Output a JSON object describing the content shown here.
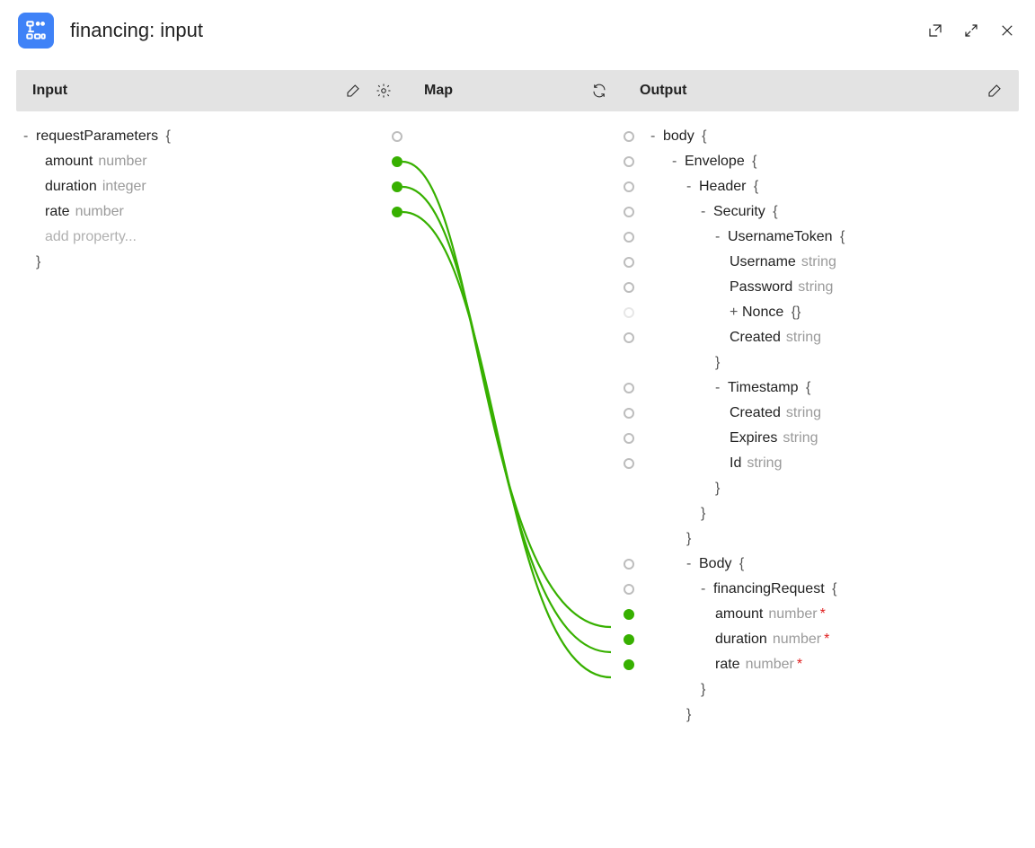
{
  "title": "financing: input",
  "columns": {
    "input": "Input",
    "map": "Map",
    "output": "Output"
  },
  "input_tree": {
    "root": {
      "key": "requestParameters",
      "open": true
    },
    "children": [
      {
        "key": "amount",
        "type": "number"
      },
      {
        "key": "duration",
        "type": "integer"
      },
      {
        "key": "rate",
        "type": "number"
      }
    ],
    "add_placeholder": "add property..."
  },
  "output_tree": {
    "body_key": "body",
    "envelope_key": "Envelope",
    "header_key": "Header",
    "security_key": "Security",
    "usernametoken_key": "UsernameToken",
    "username": {
      "key": "Username",
      "type": "string"
    },
    "password": {
      "key": "Password",
      "type": "string"
    },
    "nonce_key": "Nonce",
    "created": {
      "key": "Created",
      "type": "string"
    },
    "timestamp_key": "Timestamp",
    "ts_created": {
      "key": "Created",
      "type": "string"
    },
    "ts_expires": {
      "key": "Expires",
      "type": "string"
    },
    "ts_id": {
      "key": "Id",
      "type": "string"
    },
    "soapbody_key": "Body",
    "finreq_key": "financingRequest",
    "amount": {
      "key": "amount",
      "type": "number"
    },
    "duration": {
      "key": "duration",
      "type": "number"
    },
    "rate": {
      "key": "rate",
      "type": "number"
    }
  },
  "mappings": [
    {
      "from": "input_tree.children.0.key",
      "to": "output_tree.amount.key"
    },
    {
      "from": "input_tree.children.1.key",
      "to": "output_tree.duration.key"
    },
    {
      "from": "input_tree.children.2.key",
      "to": "output_tree.rate.key"
    }
  ]
}
